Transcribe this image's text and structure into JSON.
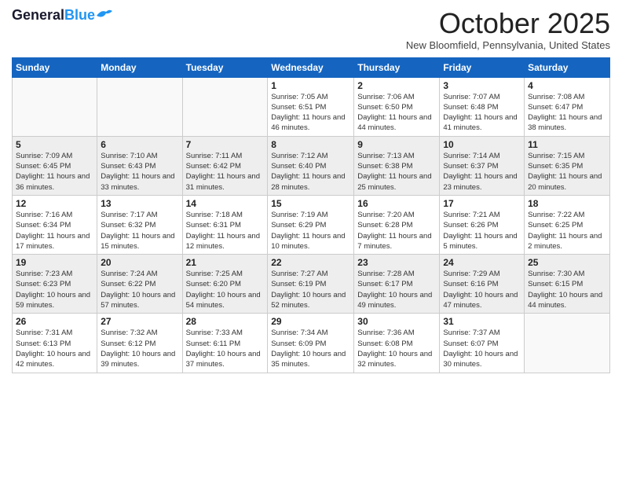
{
  "header": {
    "logo_line1": "General",
    "logo_line2": "Blue",
    "month": "October 2025",
    "location": "New Bloomfield, Pennsylvania, United States"
  },
  "days_of_week": [
    "Sunday",
    "Monday",
    "Tuesday",
    "Wednesday",
    "Thursday",
    "Friday",
    "Saturday"
  ],
  "weeks": [
    [
      {
        "num": "",
        "info": ""
      },
      {
        "num": "",
        "info": ""
      },
      {
        "num": "",
        "info": ""
      },
      {
        "num": "1",
        "info": "Sunrise: 7:05 AM\nSunset: 6:51 PM\nDaylight: 11 hours and 46 minutes."
      },
      {
        "num": "2",
        "info": "Sunrise: 7:06 AM\nSunset: 6:50 PM\nDaylight: 11 hours and 44 minutes."
      },
      {
        "num": "3",
        "info": "Sunrise: 7:07 AM\nSunset: 6:48 PM\nDaylight: 11 hours and 41 minutes."
      },
      {
        "num": "4",
        "info": "Sunrise: 7:08 AM\nSunset: 6:47 PM\nDaylight: 11 hours and 38 minutes."
      }
    ],
    [
      {
        "num": "5",
        "info": "Sunrise: 7:09 AM\nSunset: 6:45 PM\nDaylight: 11 hours and 36 minutes."
      },
      {
        "num": "6",
        "info": "Sunrise: 7:10 AM\nSunset: 6:43 PM\nDaylight: 11 hours and 33 minutes."
      },
      {
        "num": "7",
        "info": "Sunrise: 7:11 AM\nSunset: 6:42 PM\nDaylight: 11 hours and 31 minutes."
      },
      {
        "num": "8",
        "info": "Sunrise: 7:12 AM\nSunset: 6:40 PM\nDaylight: 11 hours and 28 minutes."
      },
      {
        "num": "9",
        "info": "Sunrise: 7:13 AM\nSunset: 6:38 PM\nDaylight: 11 hours and 25 minutes."
      },
      {
        "num": "10",
        "info": "Sunrise: 7:14 AM\nSunset: 6:37 PM\nDaylight: 11 hours and 23 minutes."
      },
      {
        "num": "11",
        "info": "Sunrise: 7:15 AM\nSunset: 6:35 PM\nDaylight: 11 hours and 20 minutes."
      }
    ],
    [
      {
        "num": "12",
        "info": "Sunrise: 7:16 AM\nSunset: 6:34 PM\nDaylight: 11 hours and 17 minutes."
      },
      {
        "num": "13",
        "info": "Sunrise: 7:17 AM\nSunset: 6:32 PM\nDaylight: 11 hours and 15 minutes."
      },
      {
        "num": "14",
        "info": "Sunrise: 7:18 AM\nSunset: 6:31 PM\nDaylight: 11 hours and 12 minutes."
      },
      {
        "num": "15",
        "info": "Sunrise: 7:19 AM\nSunset: 6:29 PM\nDaylight: 11 hours and 10 minutes."
      },
      {
        "num": "16",
        "info": "Sunrise: 7:20 AM\nSunset: 6:28 PM\nDaylight: 11 hours and 7 minutes."
      },
      {
        "num": "17",
        "info": "Sunrise: 7:21 AM\nSunset: 6:26 PM\nDaylight: 11 hours and 5 minutes."
      },
      {
        "num": "18",
        "info": "Sunrise: 7:22 AM\nSunset: 6:25 PM\nDaylight: 11 hours and 2 minutes."
      }
    ],
    [
      {
        "num": "19",
        "info": "Sunrise: 7:23 AM\nSunset: 6:23 PM\nDaylight: 10 hours and 59 minutes."
      },
      {
        "num": "20",
        "info": "Sunrise: 7:24 AM\nSunset: 6:22 PM\nDaylight: 10 hours and 57 minutes."
      },
      {
        "num": "21",
        "info": "Sunrise: 7:25 AM\nSunset: 6:20 PM\nDaylight: 10 hours and 54 minutes."
      },
      {
        "num": "22",
        "info": "Sunrise: 7:27 AM\nSunset: 6:19 PM\nDaylight: 10 hours and 52 minutes."
      },
      {
        "num": "23",
        "info": "Sunrise: 7:28 AM\nSunset: 6:17 PM\nDaylight: 10 hours and 49 minutes."
      },
      {
        "num": "24",
        "info": "Sunrise: 7:29 AM\nSunset: 6:16 PM\nDaylight: 10 hours and 47 minutes."
      },
      {
        "num": "25",
        "info": "Sunrise: 7:30 AM\nSunset: 6:15 PM\nDaylight: 10 hours and 44 minutes."
      }
    ],
    [
      {
        "num": "26",
        "info": "Sunrise: 7:31 AM\nSunset: 6:13 PM\nDaylight: 10 hours and 42 minutes."
      },
      {
        "num": "27",
        "info": "Sunrise: 7:32 AM\nSunset: 6:12 PM\nDaylight: 10 hours and 39 minutes."
      },
      {
        "num": "28",
        "info": "Sunrise: 7:33 AM\nSunset: 6:11 PM\nDaylight: 10 hours and 37 minutes."
      },
      {
        "num": "29",
        "info": "Sunrise: 7:34 AM\nSunset: 6:09 PM\nDaylight: 10 hours and 35 minutes."
      },
      {
        "num": "30",
        "info": "Sunrise: 7:36 AM\nSunset: 6:08 PM\nDaylight: 10 hours and 32 minutes."
      },
      {
        "num": "31",
        "info": "Sunrise: 7:37 AM\nSunset: 6:07 PM\nDaylight: 10 hours and 30 minutes."
      },
      {
        "num": "",
        "info": ""
      }
    ]
  ]
}
